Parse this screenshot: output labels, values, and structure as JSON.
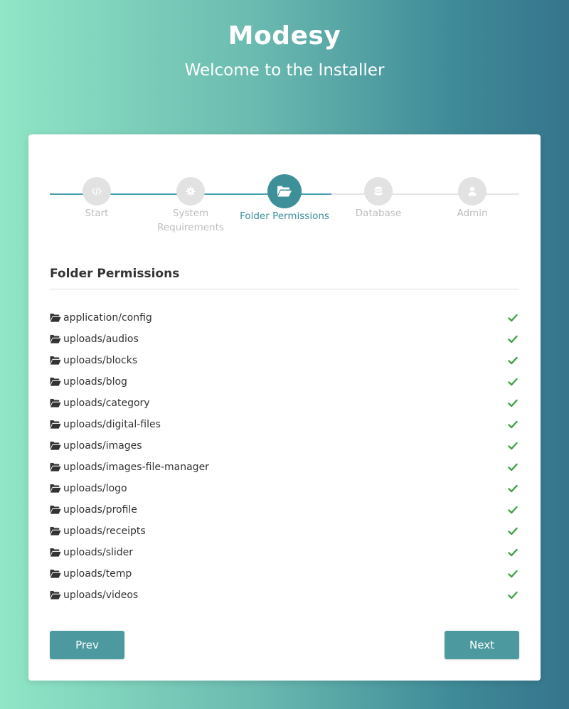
{
  "header": {
    "app_title": "Modesy",
    "subtitle": "Welcome to the Installer"
  },
  "stepper": {
    "steps": [
      {
        "label": "Start",
        "icon": "code-icon",
        "state": "done"
      },
      {
        "label": "System Requirements",
        "icon": "gear-icon",
        "state": "done"
      },
      {
        "label": "Folder Permissions",
        "icon": "folder-open-icon",
        "state": "active"
      },
      {
        "label": "Database",
        "icon": "database-icon",
        "state": "todo"
      },
      {
        "label": "Admin",
        "icon": "user-icon",
        "state": "todo"
      }
    ]
  },
  "section": {
    "title": "Folder Permissions"
  },
  "folders": [
    {
      "path": "application/config",
      "status": "ok"
    },
    {
      "path": "uploads/audios",
      "status": "ok"
    },
    {
      "path": "uploads/blocks",
      "status": "ok"
    },
    {
      "path": "uploads/blog",
      "status": "ok"
    },
    {
      "path": "uploads/category",
      "status": "ok"
    },
    {
      "path": "uploads/digital-files",
      "status": "ok"
    },
    {
      "path": "uploads/images",
      "status": "ok"
    },
    {
      "path": "uploads/images-file-manager",
      "status": "ok"
    },
    {
      "path": "uploads/logo",
      "status": "ok"
    },
    {
      "path": "uploads/profile",
      "status": "ok"
    },
    {
      "path": "uploads/receipts",
      "status": "ok"
    },
    {
      "path": "uploads/slider",
      "status": "ok"
    },
    {
      "path": "uploads/temp",
      "status": "ok"
    },
    {
      "path": "uploads/videos",
      "status": "ok"
    }
  ],
  "buttons": {
    "prev_label": "Prev",
    "next_label": "Next"
  },
  "colors": {
    "accent": "#3d8f98",
    "button": "#4c9aa0",
    "check": "#43a047",
    "inactive_step": "#e2e2e2"
  }
}
